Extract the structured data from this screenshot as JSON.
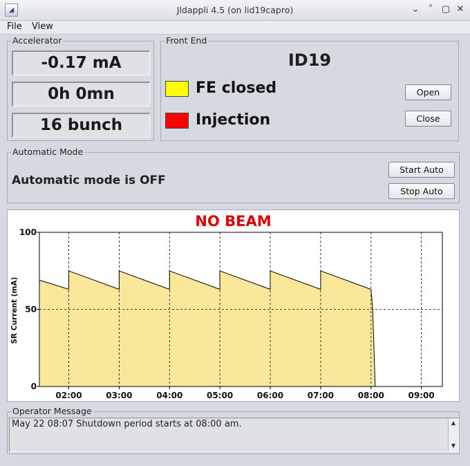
{
  "window": {
    "title": "Jldappli  4.5 (on lid19capro)",
    "minimize_glyph": "⌄",
    "restore_glyph": "˄",
    "maximize_glyph": "▢",
    "close_glyph": "✕",
    "icon": "app-icon"
  },
  "menu": [
    "File",
    "View"
  ],
  "accelerator": {
    "title": "Accelerator",
    "current": "-0.17 mA",
    "lifetime": "0h 0mn",
    "filling_mode": "16 bunch"
  },
  "front_end": {
    "title": "Front End",
    "beamline": "ID19",
    "fe_status": "FE closed",
    "fe_color": "#ffff00",
    "injection_status": "Injection",
    "injection_color": "#ff0000",
    "open_label": "Open",
    "close_label": "Close"
  },
  "automatic_mode": {
    "title": "Automatic Mode",
    "status": "Automatic mode is OFF",
    "start_label": "Start Auto",
    "stop_label": "Stop Auto"
  },
  "chart_data": {
    "type": "area",
    "title": "NO BEAM",
    "title_color": "#e00000",
    "xlabel": "",
    "ylabel": "SR Current (mA)",
    "xlim": [
      "01:25",
      "09:25"
    ],
    "ylim": [
      0,
      100
    ],
    "yticks": [
      0,
      50,
      100
    ],
    "xticks": [
      "02:00",
      "03:00",
      "04:00",
      "05:00",
      "06:00",
      "07:00",
      "08:00",
      "09:00"
    ],
    "grid": "dashed at x ticks and y=50",
    "fill_color": "#fbe79a",
    "line_color": "#000000",
    "series": [
      {
        "x": [
          "01:25",
          "02:00",
          "02:00",
          "03:00",
          "03:00",
          "04:00",
          "04:00",
          "05:00",
          "05:00",
          "06:00",
          "06:00",
          "07:00",
          "07:00",
          "08:00",
          "08:02",
          "08:05"
        ],
        "values": [
          69,
          63,
          75,
          63,
          75,
          63,
          75,
          63,
          75,
          63,
          75,
          63,
          75,
          63,
          50,
          0
        ]
      }
    ]
  },
  "operator_message": {
    "title": "Operator Message",
    "text": "May 22 08:07 Shutdown period starts at 08:00 am.",
    "scroll_up_glyph": "▲",
    "scroll_down_glyph": "▼"
  }
}
